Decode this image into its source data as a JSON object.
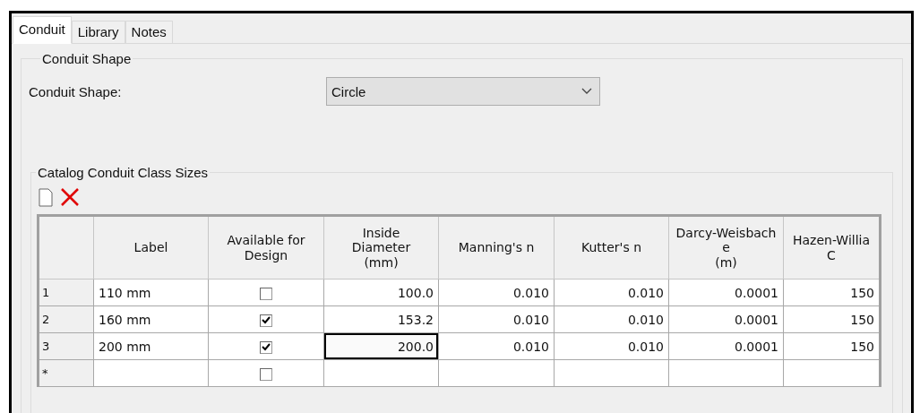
{
  "tabs": [
    {
      "label": "Conduit",
      "selected": true
    },
    {
      "label": "Library",
      "selected": false
    },
    {
      "label": "Notes",
      "selected": false
    }
  ],
  "shape_group": {
    "title": "Conduit Shape",
    "field_label": "Conduit Shape:",
    "value": "Circle"
  },
  "catalog": {
    "title": "Catalog Conduit Class Sizes",
    "columns": [
      "Label",
      "Available for\nDesign",
      "Inside\nDiameter\n(mm)",
      "Manning's n",
      "Kutter's n",
      "Darcy-Weisbach\ne\n(m)",
      "Hazen-Willia\nC"
    ],
    "rows": [
      {
        "header": "1",
        "label": "110 mm",
        "available": false,
        "diameter": "100.0",
        "diameter_focused": false,
        "values": [
          "0.010",
          "0.010",
          "0.0001",
          "150"
        ]
      },
      {
        "header": "2",
        "label": "160 mm",
        "available": true,
        "diameter": "153.2",
        "diameter_focused": false,
        "values": [
          "0.010",
          "0.010",
          "0.0001",
          "150"
        ]
      },
      {
        "header": "3",
        "label": "200 mm",
        "available": true,
        "diameter": "200.0",
        "diameter_focused": true,
        "values": [
          "0.010",
          "0.010",
          "0.0001",
          "150"
        ]
      }
    ],
    "new_row": {
      "header": "*",
      "available": false
    }
  }
}
